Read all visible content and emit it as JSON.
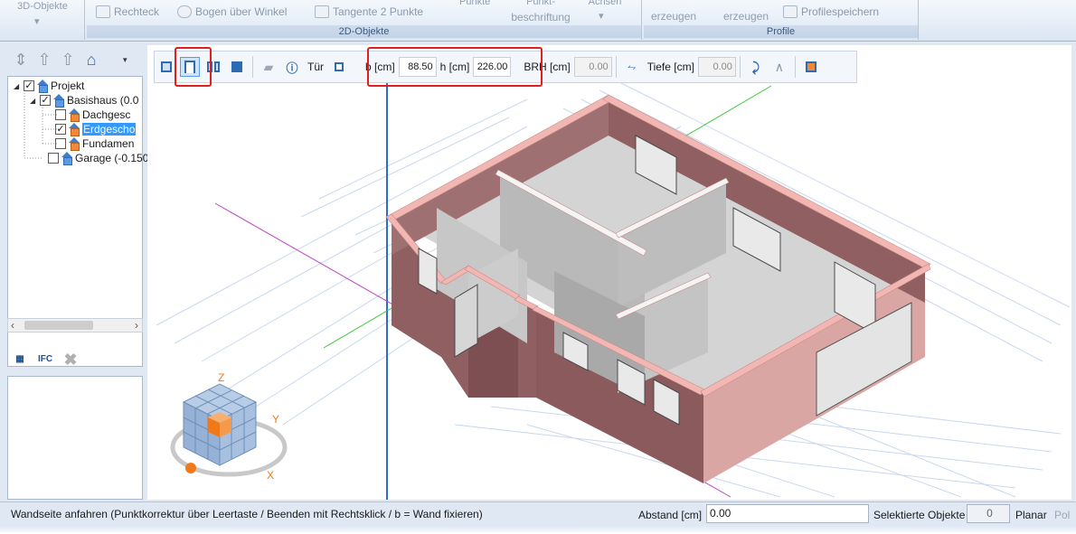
{
  "ribbon": {
    "group_3d": "3D-Objekte",
    "item_rechteck": "Rechteck",
    "item_bogen": "Bogen über Winkel",
    "item_tangente": "Tangente 2 Punkte",
    "item_punkte": "Punkte",
    "item_punktbeschriftung_top": "Punkt-",
    "item_punktbeschriftung": "beschriftung",
    "item_achsen": "Achsen",
    "group_2d": "2D-Objekte",
    "item_erzeugen1": "erzeugen",
    "item_erzeugen2": "erzeugen",
    "item_profilspeichern": "Profilespeichern",
    "group_profile": "Profile"
  },
  "tree": {
    "items": [
      {
        "label": "Projekt",
        "checked": true
      },
      {
        "label": "Basishaus (0.0",
        "checked": true
      },
      {
        "label": "Dachgesc",
        "checked": false
      },
      {
        "label": "Erdgescho",
        "checked": true
      },
      {
        "label": "Fundamen",
        "checked": false
      },
      {
        "label": "Garage (-0.150",
        "checked": false
      }
    ]
  },
  "leftpanel": {
    "ifc_label": "IFC"
  },
  "toolbar": {
    "door_label": "Tür",
    "b_label": "b [cm]",
    "b_value": "88.50",
    "h_label": "h [cm]",
    "h_value": "226.00",
    "brh_label": "BRH [cm]",
    "brh_value": "0.00",
    "tiefe_label": "Tiefe [cm]",
    "tiefe_value": "0.00"
  },
  "status": {
    "message": "Wandseite anfahren (Punktkorrektur über Leertaste / Beenden mit Rechtsklick / b = Wand fixieren)",
    "abstand_label": "Abstand [cm]",
    "abstand_value": "0.00",
    "selektierte_label": "Selektierte Objekte",
    "selektierte_value": "0",
    "planar_label": "Planar",
    "pol_label": "Pol"
  },
  "colors": {
    "wall_top": "#f2b7b3",
    "wall_outer": "#8f5f61",
    "wall_inner": "#c9c9c9",
    "floor": "#d8d8d8",
    "accent_red": "#e02020",
    "axis_blue": "#2f6bd3",
    "axis_green": "#3cc83c",
    "axis_magenta": "#c040c0",
    "cube_orange": "#f07a1a",
    "cube_blue": "#9ab6d8"
  }
}
